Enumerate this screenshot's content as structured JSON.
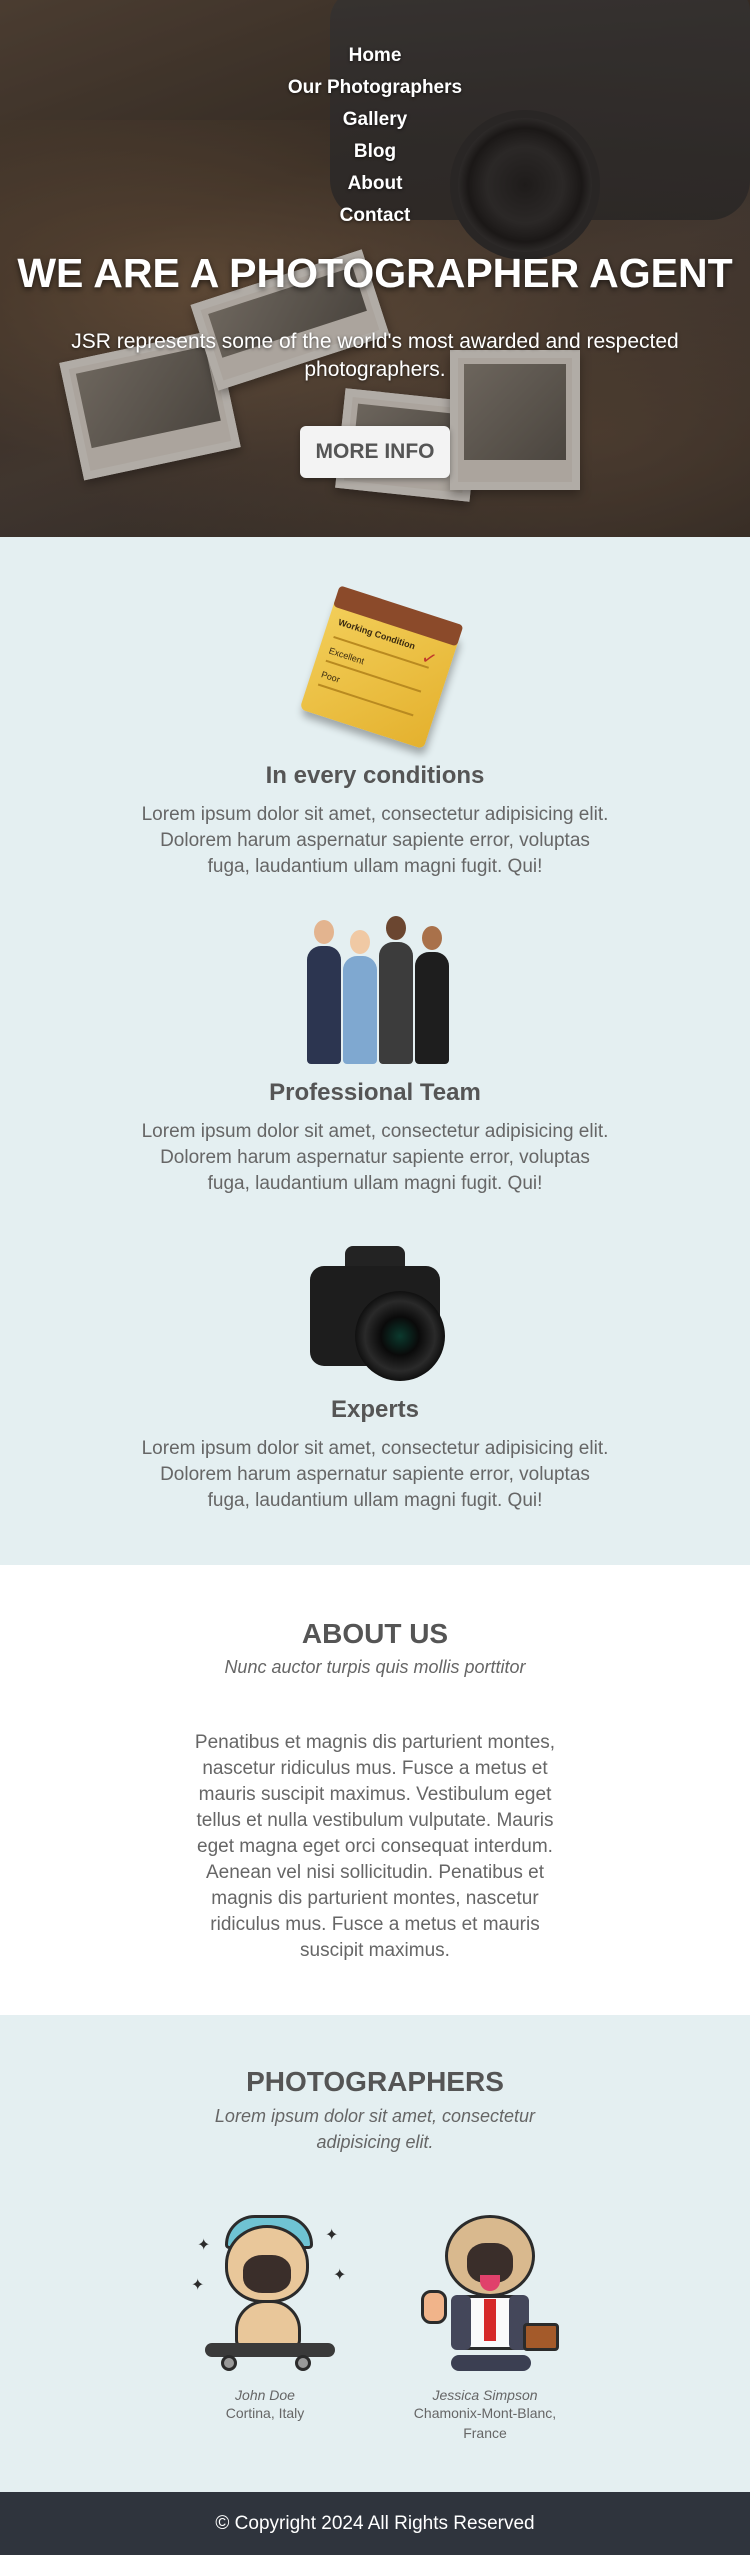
{
  "nav": {
    "items": [
      "Home",
      "Our Photographers",
      "Gallery",
      "Blog",
      "About",
      "Contact"
    ]
  },
  "hero": {
    "title": "WE ARE A PHOTOGRAPHER AGENT",
    "subtitle": "JSR represents some of the world's most awarded and respected photographers.",
    "button_label": "MORE INFO"
  },
  "features": [
    {
      "icon": "notepad-icon",
      "title": "In every conditions",
      "text": "Lorem ipsum dolor sit amet, consectetur adipisicing elit. Dolorem harum aspernatur sapiente error, voluptas fuga, laudantium ullam magni fugit. Qui!",
      "notepad_lines": [
        "Working Condition",
        "Excellent",
        "Poor"
      ]
    },
    {
      "icon": "team-icon",
      "title": "Professional Team",
      "text": "Lorem ipsum dolor sit amet, consectetur adipisicing elit. Dolorem harum aspernatur sapiente error, voluptas fuga, laudantium ullam magni fugit. Qui!"
    },
    {
      "icon": "camera-icon",
      "title": "Experts",
      "text": "Lorem ipsum dolor sit amet, consectetur adipisicing elit. Dolorem harum aspernatur sapiente error, voluptas fuga, laudantium ullam magni fugit. Qui!"
    }
  ],
  "about": {
    "title": "ABOUT US",
    "tagline": "Nunc auctor turpis quis mollis porttitor",
    "body": "Penatibus et magnis dis parturient montes, nascetur ridiculus mus. Fusce a metus et mauris suscipit maximus. Vestibulum eget tellus et nulla vestibulum vulputate. Mauris eget magna eget orci consequat interdum. Aenean vel nisi sollicitudin. Penatibus et magnis dis parturient montes, nascetur ridiculus mus. Fusce a metus et mauris suscipit maximus."
  },
  "photographers": {
    "title": "PHOTOGRAPHERS",
    "tagline": "Lorem ipsum dolor sit amet, consectetur adipisicing elit.",
    "people": [
      {
        "name": "John Doe",
        "location": "Cortina, Italy",
        "avatar": "skater-pug-icon"
      },
      {
        "name": "Jessica Simpson",
        "location": "Chamonix-Mont-Blanc, France",
        "avatar": "business-pug-icon"
      }
    ]
  },
  "footer": {
    "text": "© Copyright 2024 All Rights Reserved"
  },
  "colors": {
    "section_bg": "#e4eff1",
    "footer_bg": "#2f343d",
    "heading": "#555555"
  }
}
